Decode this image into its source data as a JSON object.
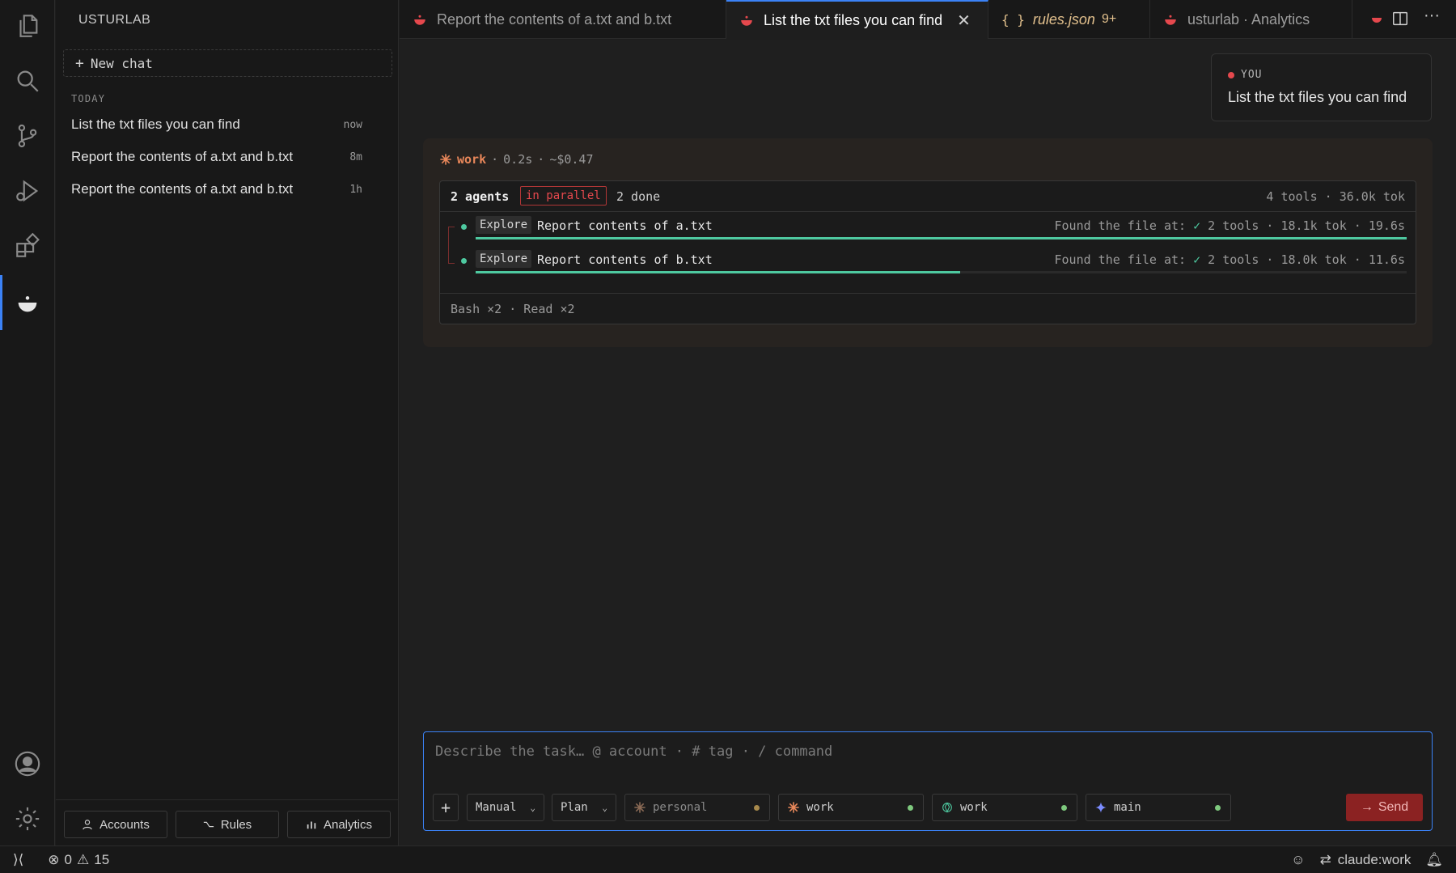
{
  "sidebar": {
    "title": "USTURLAB",
    "new_chat": "New chat",
    "section": "TODAY",
    "chats": [
      {
        "label": "List the txt files you can find",
        "age": "now"
      },
      {
        "label": "Report the contents of a.txt and b.txt",
        "age": "8m"
      },
      {
        "label": "Report the contents of a.txt and b.txt",
        "age": "1h"
      }
    ],
    "bottom": {
      "accounts": "Accounts",
      "rules": "Rules",
      "analytics": "Analytics"
    }
  },
  "tabs": [
    {
      "label": "Report the contents of a.txt and b.txt",
      "icon": "usturlab-icon"
    },
    {
      "label": "List the txt files you can find",
      "icon": "usturlab-icon",
      "active": true
    },
    {
      "label": "rules.json",
      "icon": "json-icon",
      "badge": "9+"
    },
    {
      "label": "usturlab · Analytics",
      "icon": "usturlab-icon"
    }
  ],
  "conversation": {
    "you_label": "YOU",
    "you_message": "List the txt files you can find",
    "work": {
      "name": "work",
      "duration": "0.2s",
      "cost": "~$0.47",
      "agents_count": "2 agents",
      "parallel": "in parallel",
      "done": "2 done",
      "stats": "4 tools · 36.0k tok",
      "agents": [
        {
          "type": "Explore",
          "task": "Report contents of a.txt",
          "found": "Found the file at:",
          "check": "✓",
          "meta": "2 tools · 18.1k tok · 19.6s",
          "progress": 1.0
        },
        {
          "type": "Explore",
          "task": "Report contents of b.txt",
          "found": "Found the file at:",
          "check": "✓",
          "meta": "2 tools · 18.0k tok · 11.6s",
          "progress": 0.52
        }
      ],
      "footer": "Bash ×2 · Read ×2"
    }
  },
  "composer": {
    "placeholder": "Describe the task…  @ account · # tag · / command",
    "add": "+",
    "mode": "Manual",
    "plan": "Plan",
    "accounts": [
      {
        "label": "personal",
        "icon": "claude-icon",
        "status": "idle"
      },
      {
        "label": "work",
        "icon": "claude-icon",
        "status": "active"
      },
      {
        "label": "work",
        "icon": "openai-icon",
        "status": "active"
      },
      {
        "label": "main",
        "icon": "gemini-icon",
        "status": "active"
      }
    ],
    "send": "Send"
  },
  "status": {
    "errors": "0",
    "warnings": "15",
    "account": "claude:work"
  },
  "colors": {
    "accent": "#3b82f6",
    "brand_red": "#e5484d",
    "success": "#4ec9a0",
    "work_orange": "#e8875a"
  }
}
